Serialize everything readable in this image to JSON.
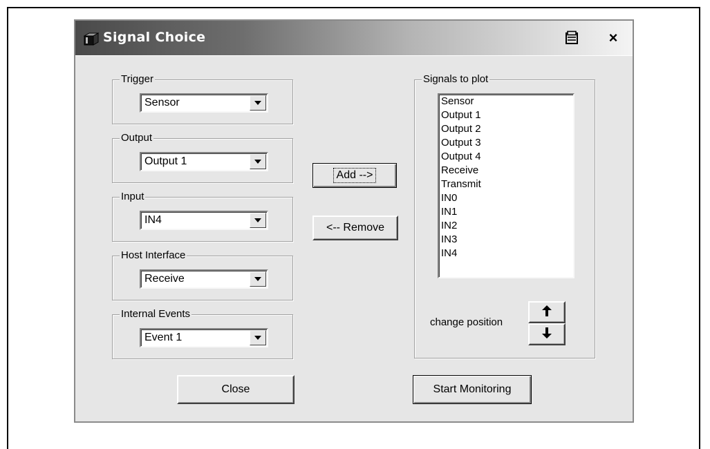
{
  "window": {
    "title": "Signal Choice",
    "close_glyph": "×"
  },
  "groups": {
    "trigger": {
      "label": "Trigger",
      "value": "Sensor"
    },
    "output": {
      "label": "Output",
      "value": "Output 1"
    },
    "input": {
      "label": "Input",
      "value": "IN4"
    },
    "host_interface": {
      "label": "Host Interface",
      "value": "Receive"
    },
    "internal_events": {
      "label": "Internal Events",
      "value": "Event 1"
    }
  },
  "buttons": {
    "add": "Add -->",
    "remove": "<-- Remove",
    "close": "Close",
    "start_monitoring": "Start Monitoring"
  },
  "signals_to_plot": {
    "label": "Signals to plot",
    "items": [
      "Sensor",
      "Output 1",
      "Output 2",
      "Output 3",
      "Output 4",
      "Receive",
      "Transmit",
      "IN0",
      "IN1",
      "IN2",
      "IN3",
      "IN4"
    ],
    "change_position_label": "change position"
  },
  "icons": {
    "app": "app-box-icon",
    "pin": "pin-window-icon",
    "close": "close-icon",
    "dropdown": "chevron-down-icon",
    "move_up": "arrow-up-icon",
    "move_down": "arrow-down-icon"
  }
}
